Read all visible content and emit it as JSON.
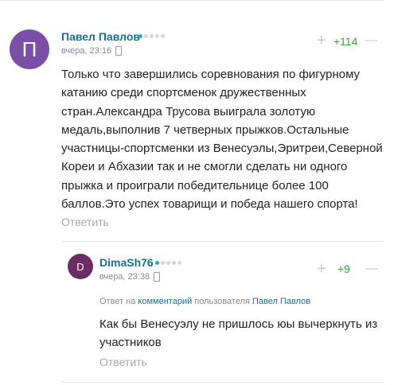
{
  "comments": [
    {
      "avatar_letter": "П",
      "avatar_color": "#7b4fa6",
      "author": "Павел Павлов",
      "time": "вчера, 23:16",
      "score": "+114",
      "score_color": "#3aa53a",
      "text": "Только что завершились соревнования по фигурному катанию среди спортсменок дружественных стран.Александра Трусова выиграла золотую медаль,выполнив 7 четверных прыжков.Остальные участницы-спортсменки из Венесуэлы,Эритреи,Северной Кореи и Абхазии так и не смогли сделать ни одного прыжка и проиграли победительнице более 100 баллов.Это успех товарищи и победа нашего спорта!",
      "reply_label": "Ответить"
    }
  ],
  "replies": [
    {
      "avatar_letter": "D",
      "avatar_color": "#6a2c63",
      "author": "DimaSh76",
      "time": "вчера, 23:38",
      "score": "+9",
      "reply_to_prefix": "Ответ на",
      "reply_to_link": "комментарий",
      "reply_to_middle": "пользователя",
      "reply_to_user": "Павел Павлов",
      "text": "Как бы Венесуэлу не пришлось юы вычеркнуть из участников",
      "reply_label": "Ответить"
    }
  ],
  "icons": {
    "plus": "+",
    "minus": "—"
  }
}
